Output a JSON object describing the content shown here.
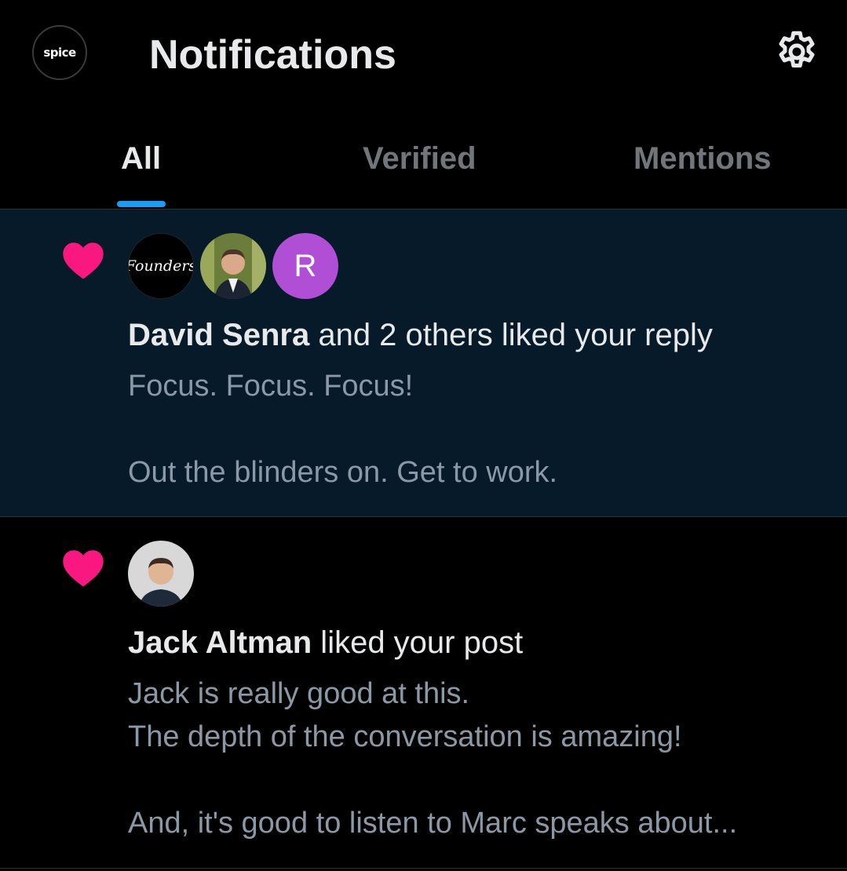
{
  "header": {
    "profile_avatar_text": "spice",
    "title": "Notifications",
    "settings_icon": "gear-icon"
  },
  "tabs": [
    {
      "label": "All",
      "active": true
    },
    {
      "label": "Verified",
      "active": false
    },
    {
      "label": "Mentions",
      "active": false
    }
  ],
  "accent_color": "#1d9bf0",
  "like_color": "#f91880",
  "notifications": [
    {
      "icon": "heart-icon",
      "avatars": [
        {
          "type": "logo",
          "text": "Founders"
        },
        {
          "type": "photo"
        },
        {
          "type": "initial",
          "text": "R",
          "color": "#b04ed6"
        }
      ],
      "actor": "David Senra",
      "action": " and 2 others liked your reply",
      "snippet": "Focus. Focus. Focus!\n\nOut the blinders on. Get to work.",
      "unread": true
    },
    {
      "icon": "heart-icon",
      "avatars": [
        {
          "type": "photo"
        }
      ],
      "actor": "Jack Altman",
      "action": " liked your post",
      "snippet": "Jack is really good at this.\nThe depth of the conversation is amazing!\n\nAnd, it's good to listen to Marc speaks about..."
    }
  ]
}
